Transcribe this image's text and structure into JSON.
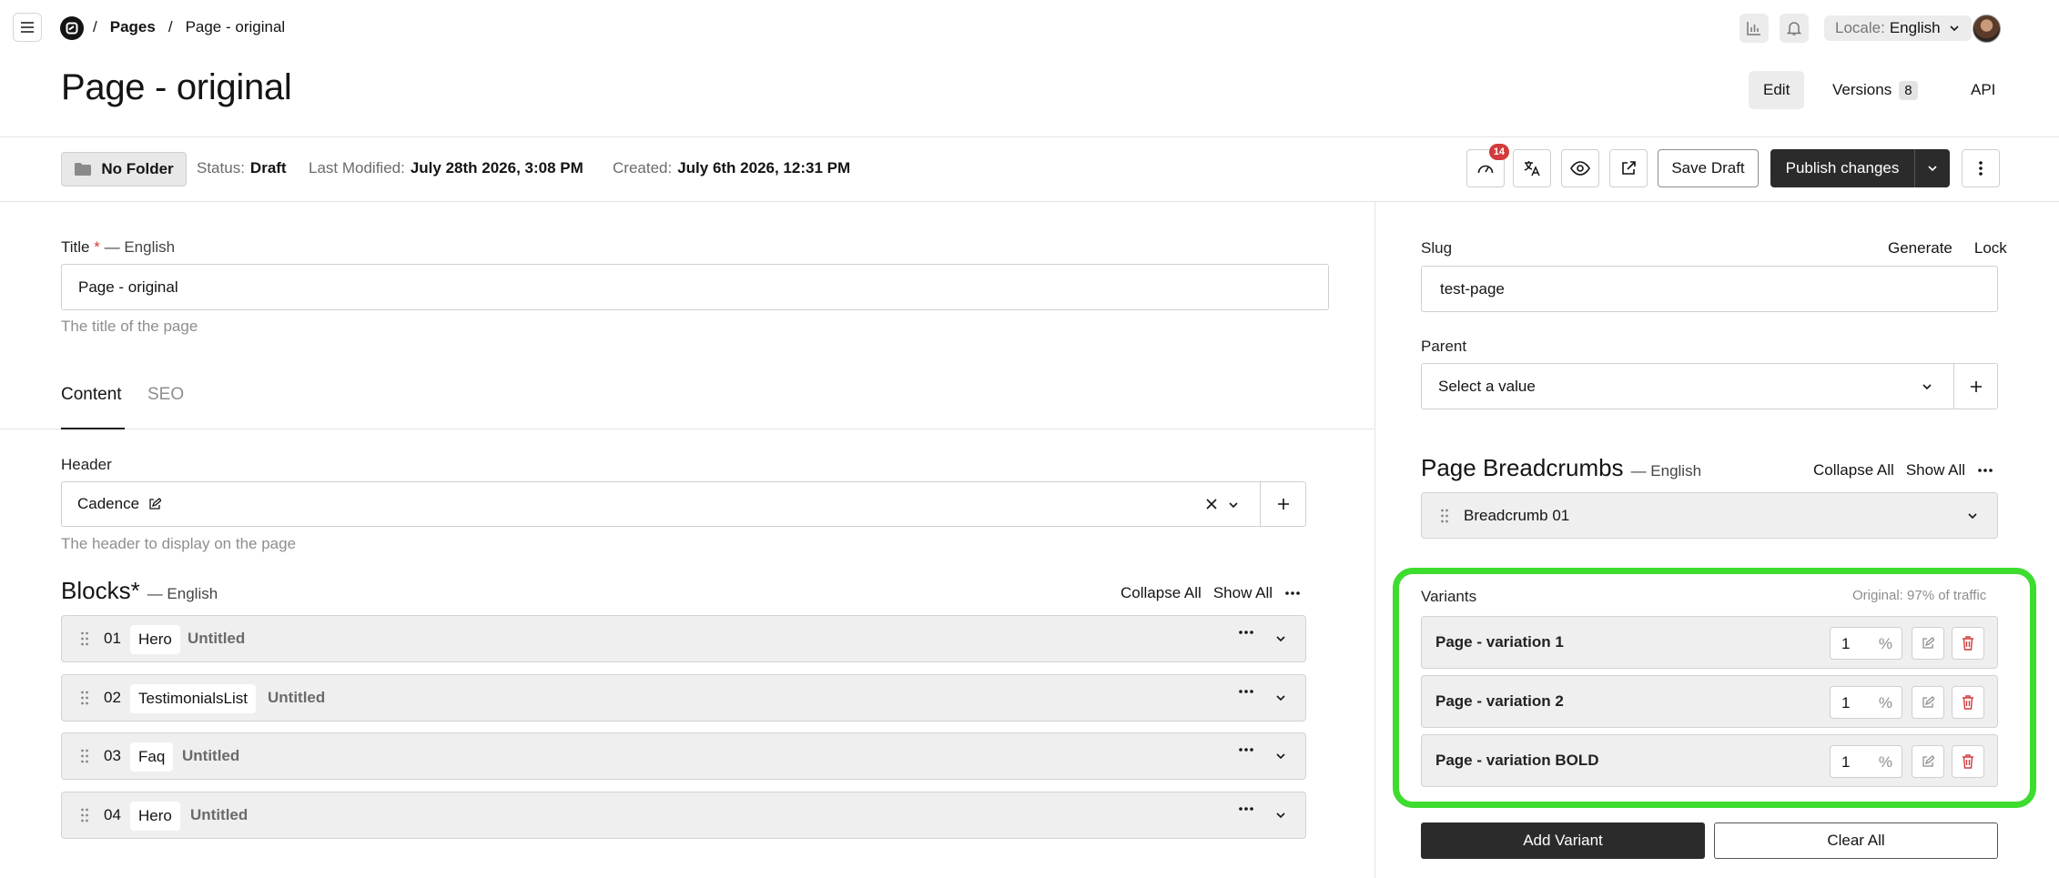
{
  "breadcrumb": {
    "root": "Pages",
    "current": "Page - original",
    "separator": "/"
  },
  "header": {
    "locale_label": "Locale:",
    "locale_value": "English"
  },
  "page": {
    "title": "Page - original"
  },
  "view_tabs": {
    "edit": "Edit",
    "versions": "Versions",
    "versions_count": "8",
    "api": "API"
  },
  "status_bar": {
    "folder": "No Folder",
    "status_label": "Status:",
    "status_value": "Draft",
    "modified_label": "Last Modified:",
    "modified_value": "July 28th 2026, 3:08 PM",
    "created_label": "Created:",
    "created_value": "July 6th 2026, 12:31 PM",
    "notifications_count": "14",
    "save_draft": "Save Draft",
    "publish": "Publish changes"
  },
  "form": {
    "title_label": "Title",
    "required_mark": "*",
    "locale_suffix": "— English",
    "title_value": "Page - original",
    "title_help": "The title of the page",
    "tabs": [
      "Content",
      "SEO"
    ],
    "header_label": "Header",
    "header_value": "Cadence",
    "header_help": "The header to display on the page",
    "blocks_heading": "Blocks*",
    "collapse_all": "Collapse All",
    "show_all": "Show All",
    "blocks": [
      {
        "num": "01",
        "type": "Hero",
        "title": "Untitled"
      },
      {
        "num": "02",
        "type": "TestimonialsList",
        "title": "Untitled"
      },
      {
        "num": "03",
        "type": "Faq",
        "title": "Untitled"
      },
      {
        "num": "04",
        "type": "Hero",
        "title": "Untitled"
      }
    ]
  },
  "sidebar": {
    "slug_label": "Slug",
    "generate": "Generate",
    "lock": "Lock",
    "slug_value": "test-page",
    "parent_label": "Parent",
    "parent_placeholder": "Select a value",
    "breadcrumbs_heading": "Page Breadcrumbs",
    "breadcrumbs_locale": "— English",
    "collapse_all": "Collapse All",
    "show_all": "Show All",
    "breadcrumb_item": "Breadcrumb 01",
    "variants_label": "Variants",
    "variants_note": "Original: 97% of traffic",
    "variants": [
      {
        "name": "Page - variation 1",
        "percent": "1"
      },
      {
        "name": "Page - variation 2",
        "percent": "1"
      },
      {
        "name": "Page - variation BOLD",
        "percent": "1"
      }
    ],
    "percent_symbol": "%",
    "add_variant": "Add Variant",
    "clear_all": "Clear All"
  },
  "colors": {
    "highlight": "#3ddc2f",
    "danger": "#d23b3b",
    "primary": "#2b2b2b"
  }
}
